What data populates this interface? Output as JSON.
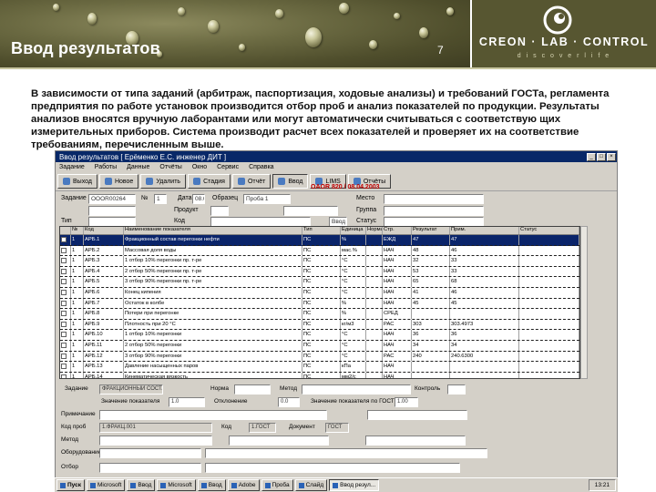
{
  "slide": {
    "title": "Ввод результатов",
    "page_number": "7",
    "brand": "CREON · LAB · CONTROL",
    "brand_sub": "d i s c o v e r   l i f e",
    "description": "В зависимости от типа заданий (арбитраж, паспортизация, ходовые анализы) и требований ГОСТа, регламента предприятия по работе установок производится отбор проб и анализ показателей по продукции. Результаты анализов вносятся вручную лаборантами или могут автоматически считываться с соответствую щих измерительных приборов. Система производит расчет всех показателей и проверяет их на соответствие требованиям, перечисленным выше."
  },
  "app": {
    "title": "Ввод результатов [ Ерёменко Е.С. инженер ДИТ ]",
    "menu": [
      "Задание",
      "Работы",
      "Данные",
      "Отчёты",
      "Окно",
      "Сервис",
      "Справка"
    ],
    "toolbar": [
      "Выход",
      "Новое",
      "Удалить",
      "Стадия",
      "Отчёт",
      "Ввод",
      "LIMS",
      "Отчёты"
    ],
    "order_code": "OAOR 820 / 08.04.2003",
    "form": {
      "labels": {
        "task": "Задание",
        "number": "№",
        "date": "Дата",
        "sample": "Образец",
        "place": "Место",
        "product": "Продукт",
        "code": "Код",
        "group": "Группа",
        "type": "Тип",
        "status": "Статус"
      },
      "values": {
        "task": "OOOR00264",
        "number": "1",
        "date": "08.04.03",
        "sample": "Проба 1",
        "status": "Ввод"
      }
    },
    "grid": {
      "columns": [
        "",
        "№",
        "Код",
        "Наименование показателя",
        "Тип",
        "Единица",
        "Норма",
        "Стр.",
        "Результат",
        "Прим.",
        "Статус"
      ],
      "rows": [
        [
          "",
          "1",
          "АРБ.1",
          "Фракционный состав перегонки нефти",
          "ПС",
          "%",
          "",
          "ЕЖД",
          "47",
          "47",
          ""
        ],
        [
          "",
          "1",
          "АРБ.2",
          "Массовая доля воды",
          "ПС",
          "мас.%",
          "",
          "НАЧ",
          "48",
          "46",
          ""
        ],
        [
          "",
          "1",
          "АРБ.3",
          "1 отбор 10% перегонки пр. т-ре",
          "ПС",
          "°С",
          "",
          "НАЧ",
          "32",
          "33",
          ""
        ],
        [
          "",
          "1",
          "АРБ.4",
          "2 отбор 50% перегонки пр. т-ре",
          "ПС",
          "°С",
          "",
          "НАЧ",
          "53",
          "33",
          ""
        ],
        [
          "",
          "1",
          "АРБ.5",
          "3 отбор 90% перегонки пр. т-ре",
          "ПС",
          "°С",
          "",
          "НАЧ",
          "65",
          "68",
          ""
        ],
        [
          "",
          "1",
          "АРБ.6",
          "Конец кипения",
          "ПС",
          "°С",
          "",
          "НАЧ",
          "41",
          "46",
          ""
        ],
        [
          "",
          "1",
          "АРБ.7",
          "Остаток в колбе",
          "ПС",
          "%",
          "",
          "НАЧ",
          "45",
          "45",
          ""
        ],
        [
          "",
          "1",
          "АРБ.8",
          "Потери при перегонке",
          "ПС",
          "%",
          "",
          "СРЕД",
          "",
          "",
          ""
        ],
        [
          "",
          "1",
          "АРБ.9",
          "Плотность при 20 °С",
          "ПС",
          "кг/м3",
          "",
          "РАС",
          "303",
          "303.4973",
          ""
        ],
        [
          "",
          "1",
          "АРБ.10",
          "1 отбор 10% перегонки",
          "ПС",
          "°С",
          "",
          "НАЧ",
          "36",
          "36",
          ""
        ],
        [
          "",
          "1",
          "АРБ.11",
          "2 отбор 50% перегонки",
          "ПС",
          "°С",
          "",
          "НАЧ",
          "34",
          "34",
          ""
        ],
        [
          "",
          "1",
          "АРБ.12",
          "3 отбор 90% перегонки",
          "ПС",
          "°С",
          "",
          "РАС",
          "240",
          "240.6300",
          ""
        ],
        [
          "",
          "1",
          "АРБ.13",
          "Давление насыщенных паров",
          "ПС",
          "кПа",
          "",
          "НАЧ",
          "",
          "",
          ""
        ],
        [
          "",
          "1",
          "АРБ.14",
          "Кинематическая вязкость",
          "ПС",
          "мм2/с",
          "",
          "НАЧ",
          "",
          "",
          ""
        ]
      ]
    },
    "bottom": {
      "r1": {
        "l1": "Задание",
        "v1": "ФРАКЦИОННЫЙ СОСТАВ",
        "l2": "Норма",
        "v2": "",
        "l3": "Метод",
        "v3": "",
        "l4": "Контроль",
        "v4": ""
      },
      "r2": {
        "l1": "Значение показателя",
        "v1": "1.0",
        "l2": "Отклонение",
        "v2": "0.0",
        "l3": "Значение показателя по ГОСТ",
        "v3": "1.00"
      },
      "r3": {
        "l1": "Примечание",
        "v1": "",
        "l2": "",
        "v2": ""
      },
      "r4": {
        "l1": "Код проб",
        "v1": "1.ФРАКЦ.001",
        "l2": "Код",
        "v2": "1.ГОСТ",
        "l3": "Документ",
        "v3": "ГОСТ"
      },
      "r5": {
        "l1": "Метод",
        "v1": "",
        "l2": "",
        "v2": "",
        "l3": "",
        "v3": ""
      },
      "r6": {
        "l1": "Оборудование",
        "v1": "",
        "l2": "",
        "v2": ""
      },
      "r7": {
        "l1": "Отбор",
        "v1": "",
        "l2": "",
        "v2": ""
      }
    },
    "taskbar": {
      "start": "Пуск",
      "items": [
        "Microsoft",
        "Ввод",
        "Microsoft",
        "Ввод",
        "Adobe",
        "Проба",
        "Слайд",
        "Ввод резул..."
      ],
      "clock": "13:21"
    }
  }
}
